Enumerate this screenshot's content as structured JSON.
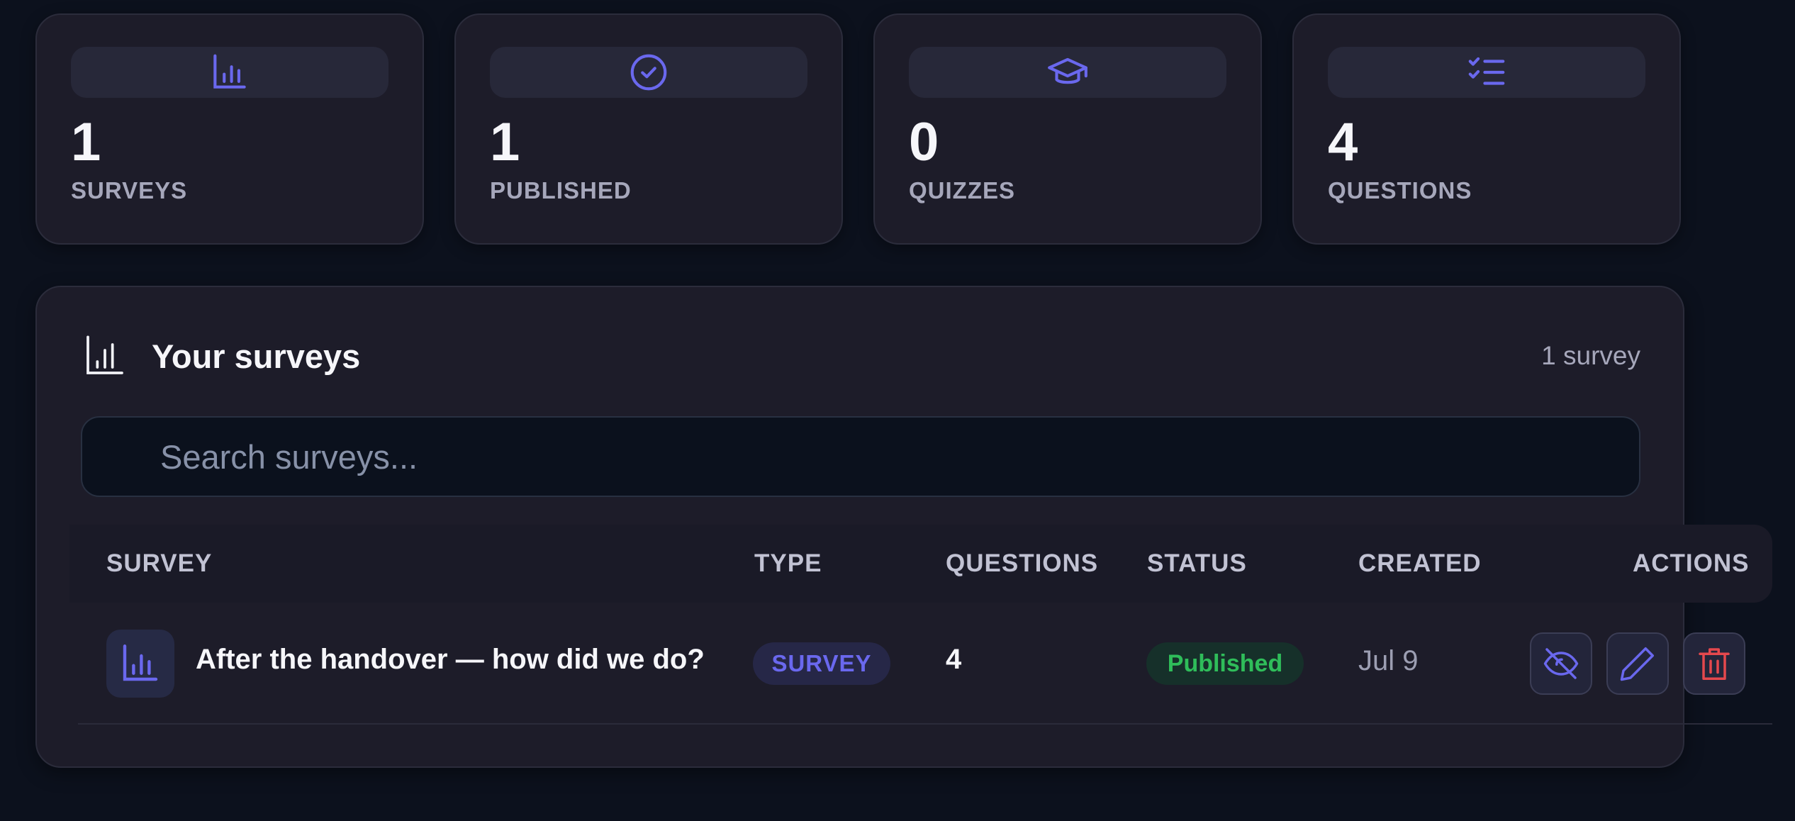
{
  "stats": [
    {
      "icon": "bar-chart-icon",
      "value": "1",
      "label": "SURVEYS"
    },
    {
      "icon": "check-circle-icon",
      "value": "1",
      "label": "PUBLISHED"
    },
    {
      "icon": "graduation-cap-icon",
      "value": "0",
      "label": "QUIZZES"
    },
    {
      "icon": "checklist-icon",
      "value": "4",
      "label": "QUESTIONS"
    }
  ],
  "panel": {
    "title": "Your surveys",
    "count": "1 survey",
    "title_icon": "bar-chart-icon"
  },
  "search": {
    "placeholder": "Search surveys..."
  },
  "table": {
    "columns": [
      "SURVEY",
      "TYPE",
      "QUESTIONS",
      "STATUS",
      "CREATED",
      "ACTIONS"
    ],
    "rows": [
      {
        "icon": "bar-chart-icon",
        "name": "After the handover — how did we do?",
        "type": "SURVEY",
        "questions": "4",
        "status": "Published",
        "created": "Jul 9",
        "actions": [
          "eye-off-icon",
          "pencil-icon",
          "trash-icon"
        ]
      }
    ]
  },
  "colors": {
    "accent": "#6a68ee",
    "published": "#2fbd5a",
    "danger": "#e5484d",
    "background": "#0c111d",
    "card": "#1d1c29"
  }
}
